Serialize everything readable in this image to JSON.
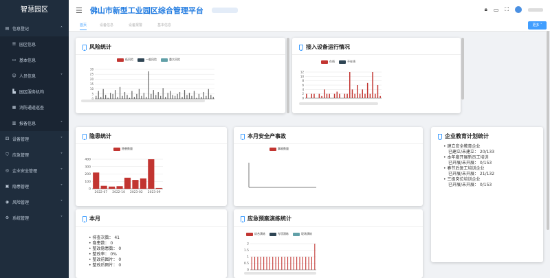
{
  "sidebar": {
    "brand": "智慧园区",
    "items": [
      {
        "label": "信息登记",
        "icon": "doc-icon",
        "chev": "˄",
        "sub": false
      },
      {
        "label": "园区信息",
        "icon": "list-icon",
        "chev": "",
        "sub": true
      },
      {
        "label": "基本信息",
        "icon": "card-icon",
        "chev": "",
        "sub": true
      },
      {
        "label": "人员信息",
        "icon": "person-icon",
        "chev": "˅",
        "sub": true
      },
      {
        "label": "园区服务机构",
        "icon": "building-icon",
        "chev": "",
        "sub": true
      },
      {
        "label": "消防通道巡查",
        "icon": "fire-icon",
        "chev": "",
        "sub": true
      },
      {
        "label": "报备信息",
        "icon": "report-icon",
        "chev": "˅",
        "sub": true
      },
      {
        "label": "设备管理",
        "icon": "device-icon",
        "chev": "˅",
        "sub": false
      },
      {
        "label": "应急管理",
        "icon": "shield-icon",
        "chev": "˅",
        "sub": false
      },
      {
        "label": "企业安全管理",
        "icon": "company-icon",
        "chev": "˅",
        "sub": false
      },
      {
        "label": "隐患管理",
        "icon": "warning-icon",
        "chev": "˅",
        "sub": false
      },
      {
        "label": "风险管理",
        "icon": "risk-icon",
        "chev": "˅",
        "sub": false
      },
      {
        "label": "系统管理",
        "icon": "gear-icon",
        "chev": "˅",
        "sub": false
      }
    ]
  },
  "header": {
    "title": "佛山市新型工业园区综合管理平台"
  },
  "tabs": [
    {
      "label": "首页",
      "active": true
    },
    {
      "label": "设备信息",
      "active": false
    },
    {
      "label": "设备报警",
      "active": false
    },
    {
      "label": "基本信息",
      "active": false
    }
  ],
  "more_button": "更多 ˅",
  "cards": {
    "risk": {
      "title": "风险统计"
    },
    "device": {
      "title": "接入设备运行情况"
    },
    "hazard": {
      "title": "隐患统计"
    },
    "accident": {
      "title": "本月安全产事故"
    },
    "edu": {
      "title": "企业教育计划统计"
    },
    "month": {
      "title": "本月"
    },
    "drill": {
      "title": "应急预案演练统计"
    }
  },
  "month_stats": [
    "排查次数： 41",
    "隐患数： 0",
    "整改隐患数： 0",
    "整改率： 0%",
    "整改前图片： 0",
    "整改后图片： 0"
  ],
  "edu_plans": [
    {
      "name": "建立安全教育企业",
      "value": "已建立/未建立： 20/133"
    },
    {
      "name": "本年度开展新员工培训",
      "value": "已开展/未开展： 0/153"
    },
    {
      "name": "春节后复工培训企业",
      "value": "已开展/未开展： 21/132"
    },
    {
      "name": "三级岗位培训企业",
      "value": "已开展/未开展： 0/153"
    }
  ],
  "chart_data": [
    {
      "id": "risk",
      "type": "bar",
      "title": "风险统计",
      "series": [
        {
          "name": "低风险",
          "color": "#c23531",
          "values": [
            3,
            8,
            2,
            10,
            4,
            1,
            6,
            5,
            9,
            2,
            12,
            3,
            7,
            4,
            1,
            8,
            2,
            5,
            10,
            3,
            6,
            2,
            28,
            5,
            9,
            4,
            7,
            3,
            11,
            2,
            6,
            8,
            4,
            3,
            5,
            7,
            2,
            9,
            4,
            6,
            3,
            8,
            1,
            5,
            2,
            7,
            3,
            10,
            4,
            2
          ]
        },
        {
          "name": "一般风险",
          "color": "#2f4554",
          "values": []
        },
        {
          "name": "重大风险",
          "color": "#61a0a8",
          "values": []
        }
      ],
      "ylim": [
        0,
        30
      ],
      "yticks": [
        "0",
        "5",
        "10",
        "15",
        "20",
        "25",
        "30"
      ]
    },
    {
      "id": "device",
      "type": "bar",
      "title": "接入设备运行情况",
      "series": [
        {
          "name": "在线",
          "color": "#c23531",
          "values": [
            2,
            0,
            2,
            2,
            0,
            2,
            1,
            4,
            2,
            2,
            0,
            2,
            3,
            2,
            0,
            2,
            2,
            12,
            4,
            2,
            6,
            2,
            4,
            2,
            7,
            2,
            12,
            2,
            6,
            1
          ]
        },
        {
          "name": "不在线",
          "color": "#2f4554",
          "values": []
        }
      ],
      "ylim": [
        0,
        12
      ],
      "yticks": [
        "0",
        "2",
        "4",
        "6",
        "8",
        "10",
        "12"
      ]
    },
    {
      "id": "hazard",
      "type": "bar",
      "title": "隐患统计",
      "series": [
        {
          "name": "隐患数量",
          "color": "#c23531",
          "values": [
            220,
            40,
            30,
            35,
            150,
            120,
            140,
            400,
            10
          ]
        }
      ],
      "categories": [
        "2022-07",
        "2022-10",
        "2023-02",
        "2023-09"
      ],
      "ylim": [
        0,
        400
      ],
      "yticks": [
        "0",
        "100",
        "200",
        "300",
        "400"
      ]
    },
    {
      "id": "accident",
      "type": "bar",
      "title": "本月安全产事故",
      "series": [
        {
          "name": "事故数量",
          "color": "#c23531",
          "values": []
        }
      ]
    },
    {
      "id": "drill",
      "type": "bar",
      "title": "应急预案演练统计",
      "series": [
        {
          "name": "综合演练",
          "color": "#c23531",
          "values": [
            1,
            1,
            1,
            1,
            1,
            1,
            1,
            1,
            1,
            1,
            1,
            1,
            1,
            1,
            1,
            1,
            1,
            1,
            1,
            1,
            1,
            2
          ]
        },
        {
          "name": "专项演练",
          "color": "#2f4554",
          "values": []
        },
        {
          "name": "现场演练",
          "color": "#61a0a8",
          "values": []
        }
      ],
      "ylim": [
        0,
        2
      ],
      "yticks": [
        "0",
        "0.5",
        "1",
        "1.5",
        "2"
      ]
    }
  ]
}
